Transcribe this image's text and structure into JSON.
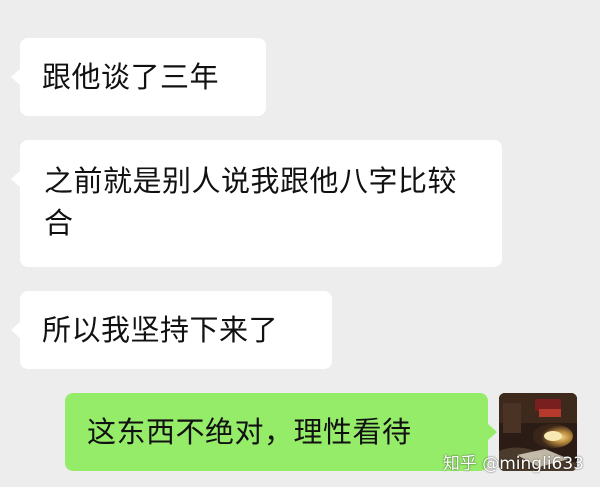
{
  "chat": {
    "messages": [
      {
        "side": "received",
        "text": "跟他谈了三年"
      },
      {
        "side": "received",
        "text": "之前就是别人说我跟他八字比较合"
      },
      {
        "side": "received",
        "text": "所以我坚持下来了"
      },
      {
        "side": "sent",
        "text": "这东西不绝对，理性看待"
      }
    ]
  },
  "watermark": "知乎 @mingli633",
  "colors": {
    "background": "#ededed",
    "received_bubble": "#ffffff",
    "sent_bubble": "#95ec69",
    "text": "#111111"
  },
  "icons": {
    "avatar": "user-avatar-photo"
  }
}
